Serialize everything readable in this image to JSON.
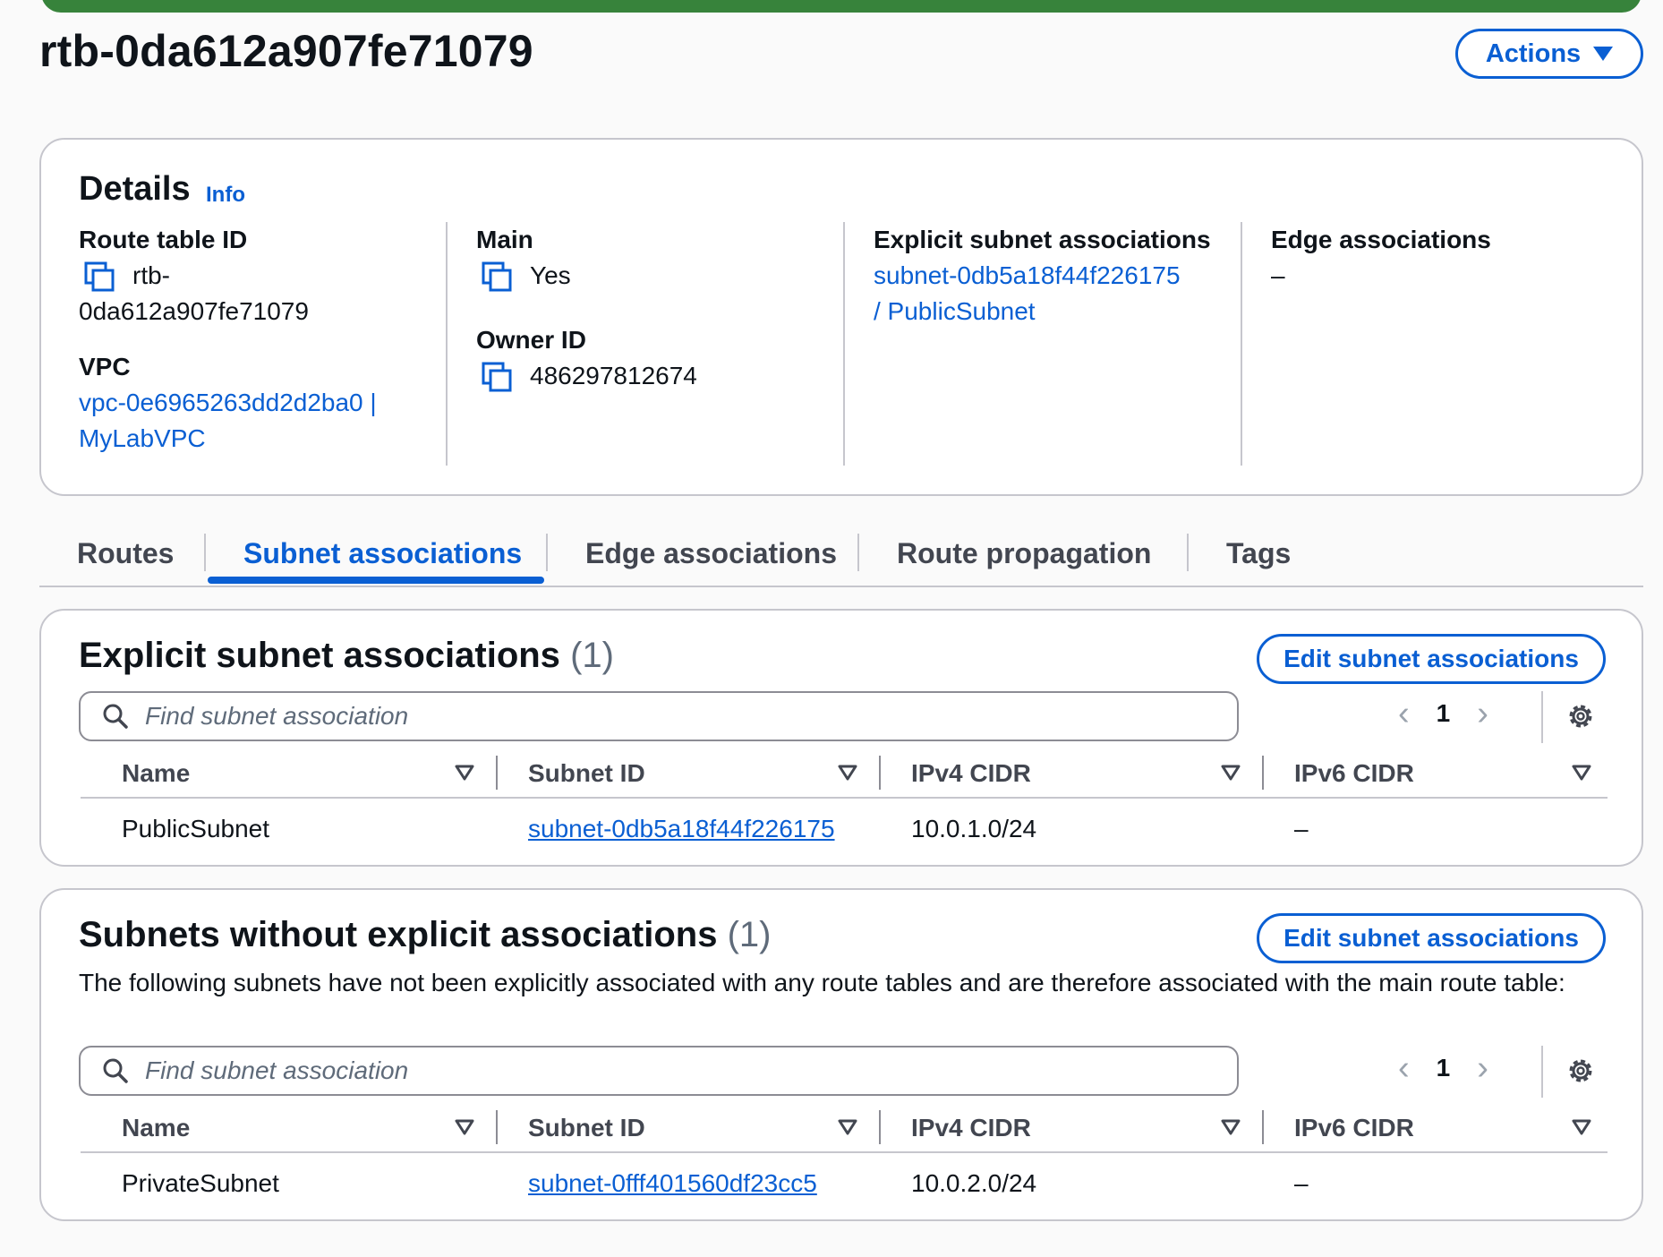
{
  "page": {
    "title": "rtb-0da612a907fe71079",
    "actions_label": "Actions"
  },
  "details": {
    "title": "Details",
    "info_label": "Info",
    "route_table_id_label": "Route table ID",
    "route_table_id_line1": "rtb-",
    "route_table_id_line2": "0da612a907fe71079",
    "vpc_label": "VPC",
    "vpc_line1": "vpc-0e6965263dd2d2ba0 |",
    "vpc_line2": "MyLabVPC",
    "main_label": "Main",
    "main_value": "Yes",
    "owner_id_label": "Owner ID",
    "owner_id_value": "486297812674",
    "explicit_label": "Explicit subnet associations",
    "explicit_line1": "subnet-0db5a18f44f226175",
    "explicit_line2": "/ PublicSubnet",
    "edge_label": "Edge associations",
    "edge_value": "–"
  },
  "tabs": [
    {
      "label": "Routes"
    },
    {
      "label": "Subnet associations",
      "active": true
    },
    {
      "label": "Edge associations"
    },
    {
      "label": "Route propagation"
    },
    {
      "label": "Tags"
    }
  ],
  "explicit_table": {
    "title": "Explicit subnet associations",
    "count": "(1)",
    "edit_label": "Edit subnet associations",
    "search_placeholder": "Find subnet association",
    "page": "1",
    "columns": [
      "Name",
      "Subnet ID",
      "IPv4 CIDR",
      "IPv6 CIDR"
    ],
    "rows": [
      {
        "name": "PublicSubnet",
        "subnet_id": "subnet-0db5a18f44f226175",
        "ipv4": "10.0.1.0/24",
        "ipv6": "–"
      }
    ]
  },
  "implicit_table": {
    "title": "Subnets without explicit associations",
    "count": "(1)",
    "edit_label": "Edit subnet associations",
    "description": "The following subnets have not been explicitly associated with any route tables and are therefore associated with the main route table:",
    "search_placeholder": "Find subnet association",
    "page": "1",
    "columns": [
      "Name",
      "Subnet ID",
      "IPv4 CIDR",
      "IPv6 CIDR"
    ],
    "rows": [
      {
        "name": "PrivateSubnet",
        "subnet_id": "subnet-0fff401560df23cc5",
        "ipv4": "10.0.2.0/24",
        "ipv6": "–"
      }
    ]
  },
  "colors": {
    "link": "#0a5fd3",
    "success_bar": "#37833b",
    "border": "#c6c6cd"
  },
  "icons": [
    "copy-icon",
    "search-icon",
    "gear-icon",
    "chevron-left-icon",
    "chevron-right-icon",
    "sort-down-icon",
    "caret-down-icon"
  ]
}
